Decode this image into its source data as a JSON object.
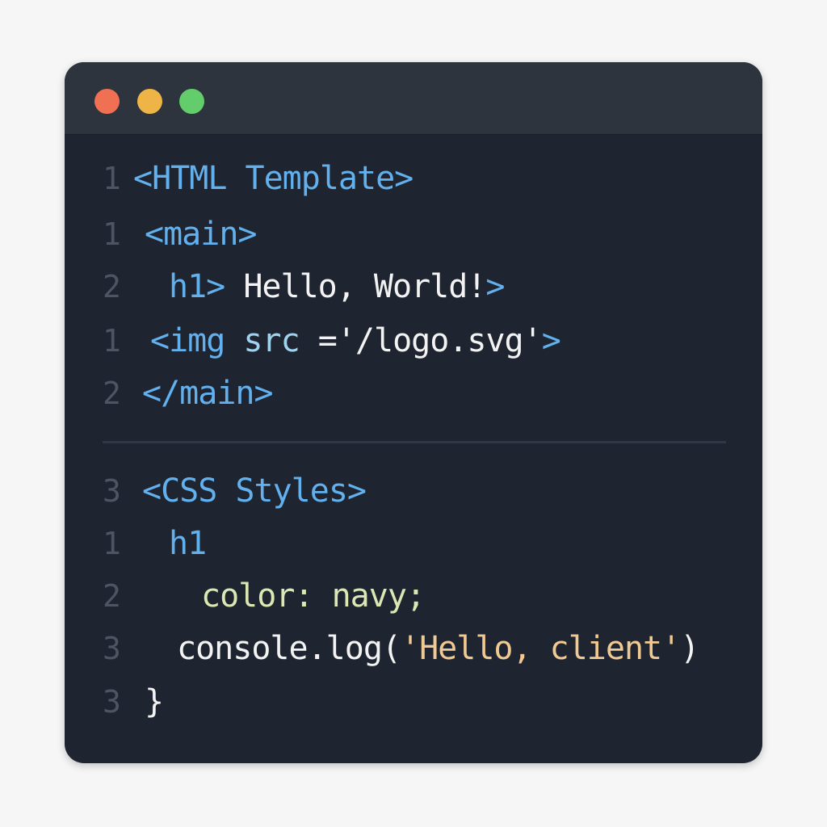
{
  "window": {
    "traffic_lights": [
      {
        "name": "close",
        "color": "#ef7052"
      },
      {
        "name": "minimize",
        "color": "#eeb446"
      },
      {
        "name": "maximize",
        "color": "#63cd6c"
      }
    ]
  },
  "html_section": {
    "lines": [
      {
        "number": "1",
        "parts": [
          "<HTML Template>"
        ]
      },
      {
        "number": "1",
        "parts": [
          "<main>"
        ]
      },
      {
        "number": "2",
        "parts": [
          "h1>",
          " Hello, World!",
          ">"
        ]
      },
      {
        "number": "1",
        "parts": [
          "<img",
          " src",
          " ='/logo.svg'",
          ">"
        ]
      },
      {
        "number": "2",
        "parts": [
          "</main>"
        ]
      }
    ]
  },
  "css_section": {
    "lines": [
      {
        "number": "3",
        "parts": [
          "<CSS Styles>"
        ]
      },
      {
        "number": "1",
        "parts": [
          "h1"
        ]
      },
      {
        "number": "2",
        "parts": [
          "color:",
          " navy;"
        ]
      },
      {
        "number": "3",
        "parts": [
          "console.log(",
          "'Hello, client'",
          ")"
        ]
      },
      {
        "number": "3",
        "parts": [
          "}"
        ]
      }
    ]
  }
}
